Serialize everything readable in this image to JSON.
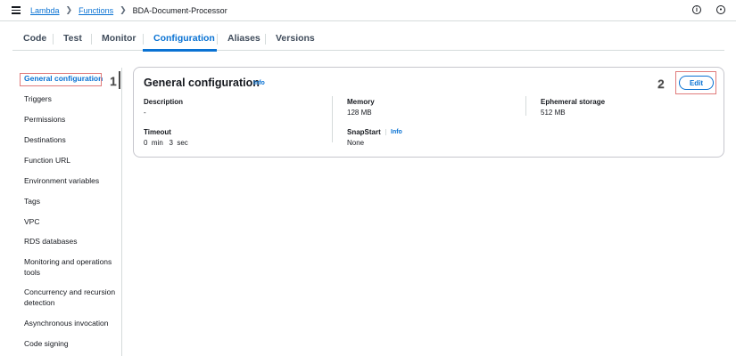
{
  "breadcrumb": {
    "items": [
      "Lambda",
      "Functions"
    ],
    "current": "BDA-Document-Processor"
  },
  "header": {
    "info_icon": "info-icon",
    "settings_icon": "settings-icon"
  },
  "tabs": [
    {
      "label": "Code"
    },
    {
      "label": "Test"
    },
    {
      "label": "Monitor"
    },
    {
      "label": "Configuration",
      "active": true
    },
    {
      "label": "Aliases"
    },
    {
      "label": "Versions"
    }
  ],
  "sidebar": {
    "items": [
      {
        "label": "General configuration",
        "active": true
      },
      {
        "label": "Triggers"
      },
      {
        "label": "Permissions"
      },
      {
        "label": "Destinations"
      },
      {
        "label": "Function URL"
      },
      {
        "label": "Environment variables"
      },
      {
        "label": "Tags"
      },
      {
        "label": "VPC"
      },
      {
        "label": "RDS databases"
      },
      {
        "label": "Monitoring and operations tools"
      },
      {
        "label": "Concurrency and recursion detection"
      },
      {
        "label": "Asynchronous invocation"
      },
      {
        "label": "Code signing"
      }
    ]
  },
  "annotations": {
    "marker_1": "1",
    "marker_2": "2"
  },
  "card": {
    "title": "General configuration",
    "info": "Info",
    "edit_label": "Edit",
    "fields": {
      "description": {
        "label": "Description",
        "value": "-"
      },
      "memory": {
        "label": "Memory",
        "value": "128  MB"
      },
      "ephemeral": {
        "label": "Ephemeral storage",
        "value": "512  MB"
      },
      "timeout": {
        "label": "Timeout",
        "value": "0  min   3  sec"
      },
      "snapstart": {
        "label": "SnapStart",
        "info": "Info",
        "value": "None"
      }
    }
  },
  "colors": {
    "accent": "#0972d3",
    "highlight": "#e07b7b",
    "border": "#d5dbdb"
  }
}
